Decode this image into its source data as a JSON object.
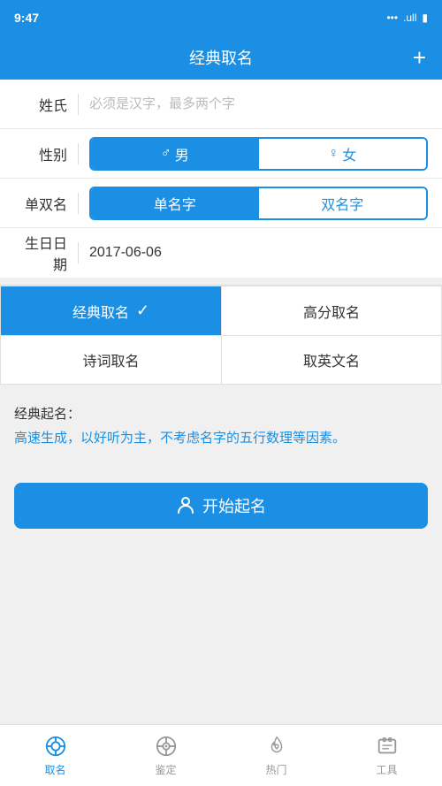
{
  "statusBar": {
    "time": "9:47",
    "icons": "... .ull ▮"
  },
  "header": {
    "title": "经典取名",
    "plusLabel": "+"
  },
  "form": {
    "surnameLabel": "姓氏",
    "surnamePlaceholder": "必须是汉字，最多两个字",
    "genderLabel": "性别",
    "genderMale": "男",
    "genderFemale": "女",
    "singleDoubleLabel": "单双名",
    "singleName": "单名字",
    "doubleName": "双名字",
    "birthdateLabel": "生日日期",
    "birthdateValue": "2017-06-06"
  },
  "nameTypes": [
    {
      "label": "经典取名",
      "active": true
    },
    {
      "label": "高分取名",
      "active": false
    },
    {
      "label": "诗词取名",
      "active": false
    },
    {
      "label": "取英文名",
      "active": false
    }
  ],
  "description": {
    "title": "经典起名：",
    "body": "高速生成，以好听为主，不考虑名字的五行数理等因素。"
  },
  "startButton": {
    "label": "开始起名"
  },
  "bottomNav": [
    {
      "label": "取名",
      "active": true
    },
    {
      "label": "鉴定",
      "active": false
    },
    {
      "label": "热门",
      "active": false
    },
    {
      "label": "工具",
      "active": false
    }
  ]
}
